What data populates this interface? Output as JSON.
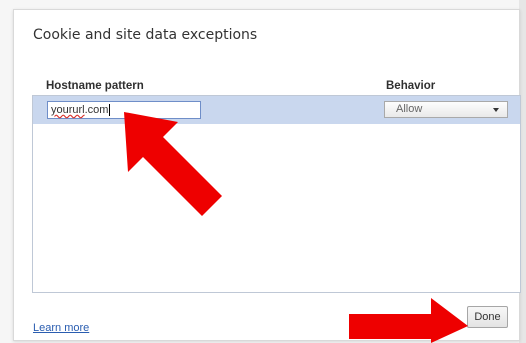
{
  "dialog": {
    "title": "Cookie and site data exceptions"
  },
  "list": {
    "headers": {
      "hostname": "Hostname pattern",
      "behavior": "Behavior"
    },
    "row": {
      "hostname_value": "yoururl.com",
      "hostname_underlined_part": "yoururl",
      "hostname_rest": ".com",
      "behavior_value": "Allow"
    }
  },
  "footer": {
    "learn_more": "Learn more",
    "done_label": "Done"
  },
  "annotations": {
    "arrow_color": "#ee0000",
    "arrows": [
      "arrow-pointing-to-hostname-input",
      "arrow-pointing-to-done-button"
    ]
  },
  "colors": {
    "selection_highlight": "#c9d7ee",
    "link": "#2a5db0"
  }
}
